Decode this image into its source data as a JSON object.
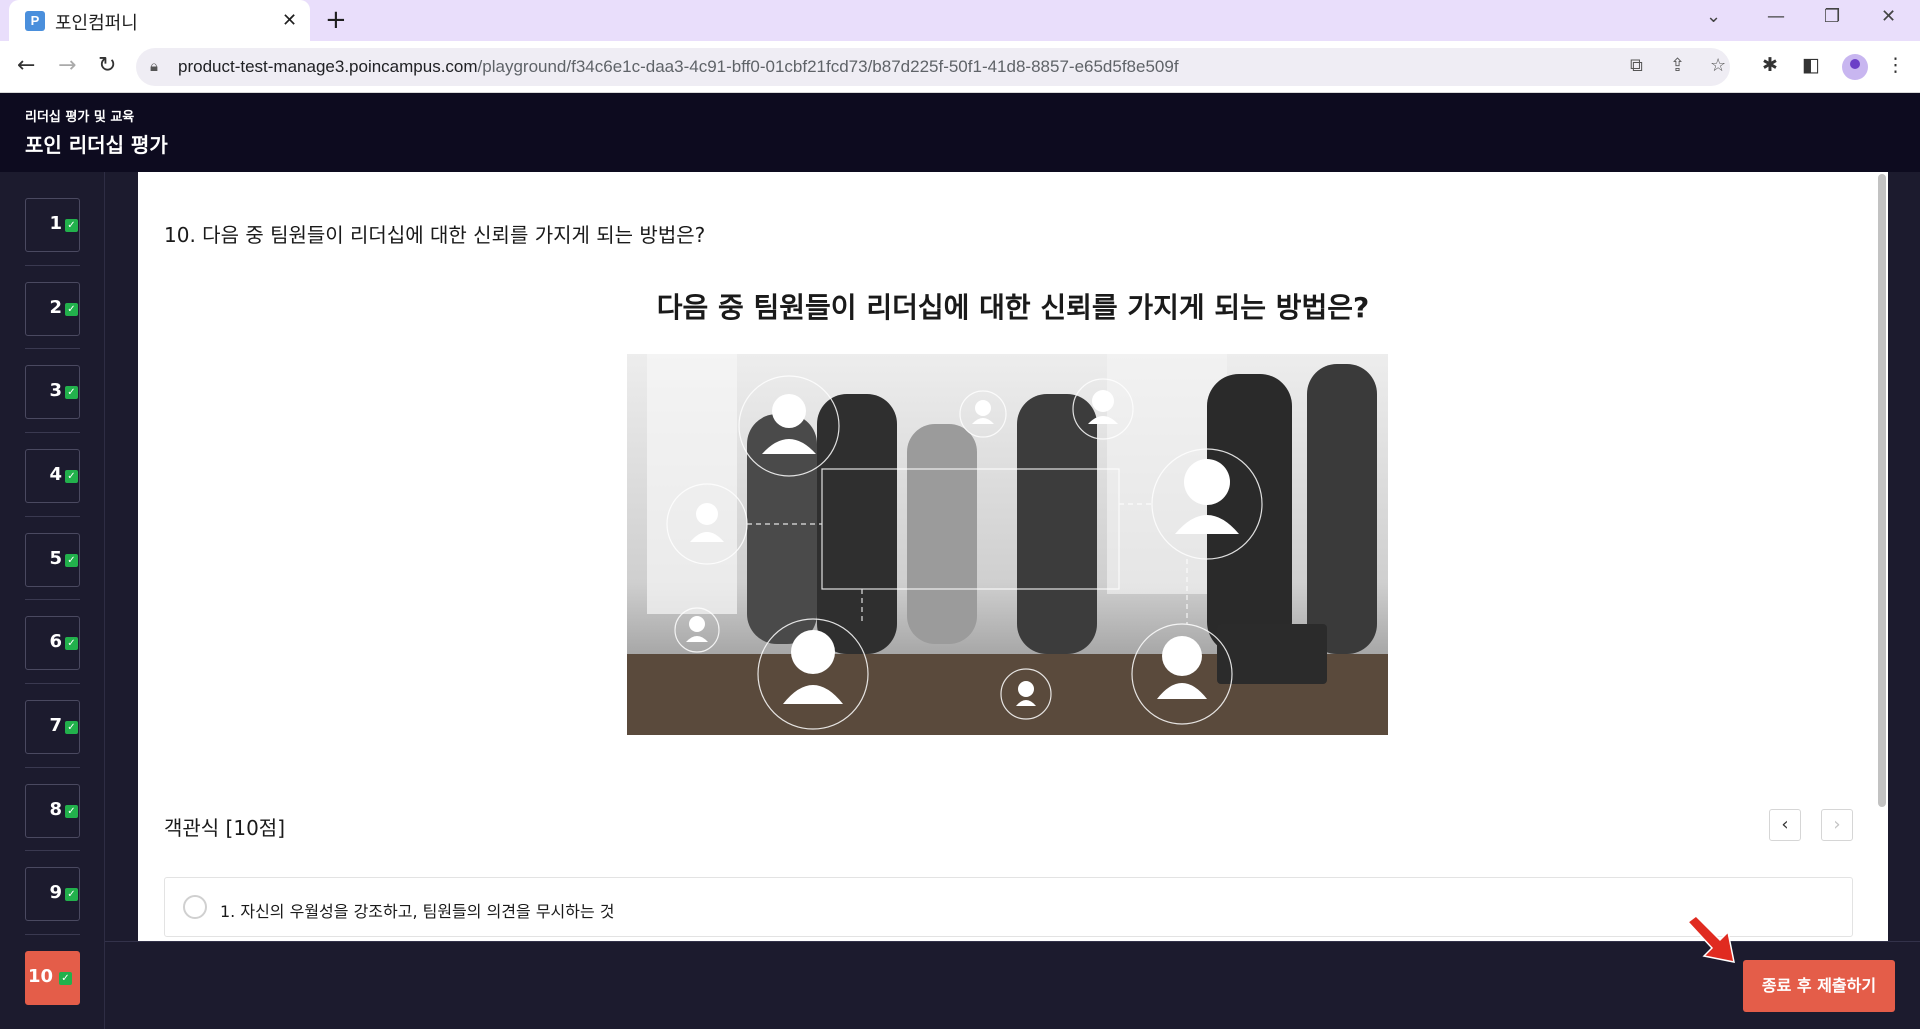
{
  "browser": {
    "tab_title": "포인컴퍼니",
    "favicon_letter": "P",
    "url_host": "product-test-manage3.poincampus.com",
    "url_path": "/playground/f34c6e1c-daa3-4c91-bff0-01cbf21fcd73/b87d225f-50f1-41d8-8857-e65d5f8e509f"
  },
  "header": {
    "subtitle": "리더십 평가 및 교육",
    "title": "포인 리더십 평가"
  },
  "sidebar": {
    "items": [
      {
        "label": "1",
        "checked": true
      },
      {
        "label": "2",
        "checked": true
      },
      {
        "label": "3",
        "checked": true
      },
      {
        "label": "4",
        "checked": true
      },
      {
        "label": "5",
        "checked": true
      },
      {
        "label": "6",
        "checked": true
      },
      {
        "label": "7",
        "checked": true
      },
      {
        "label": "8",
        "checked": true
      },
      {
        "label": "9",
        "checked": true
      },
      {
        "label": "10",
        "checked": true,
        "active": true
      }
    ]
  },
  "question": {
    "header": "10. 다음 중 팀원들이 리더십에 대한 신뢰를 가지게 되는 방법은?",
    "big_title": "다음 중 팀원들이 리더십에 대한 신뢰를 가지게 되는 방법은?",
    "type_label": "객관식 [10점]",
    "options": [
      {
        "label": "1. 자신의 우월성을 강조하고, 팀원들의 의견을 무시하는 것"
      }
    ]
  },
  "footer": {
    "submit_label": "종료 후 제출하기"
  },
  "colors": {
    "accent": "#e45d49",
    "header_bg": "#0d0b1f",
    "sidebar_bg": "#1c1b2e",
    "check": "#22b14c"
  }
}
